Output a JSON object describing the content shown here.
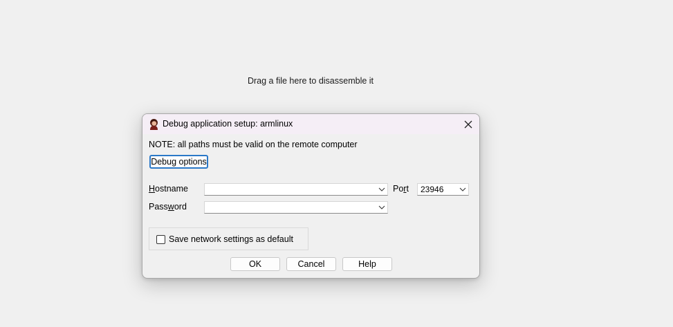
{
  "background": {
    "drop_hint": "Drag a file here to disassemble it"
  },
  "dialog": {
    "title": "Debug application setup: armlinux",
    "app_icon": "ida-avatar-icon",
    "close_icon": "close-icon",
    "note": "NOTE: all paths must be valid on the remote computer",
    "debug_options_label": "Debug options",
    "hostname": {
      "label_underlined": "H",
      "label_rest": "ostname",
      "value": ""
    },
    "port": {
      "label_pre": "Po",
      "label_underlined": "r",
      "label_post": "t",
      "value": "23946"
    },
    "password": {
      "label_pre": "Pass",
      "label_underlined": "w",
      "label_post": "ord",
      "value": ""
    },
    "save_default": {
      "label": "Save network settings as default",
      "checked": false
    },
    "buttons": {
      "ok": "OK",
      "cancel": "Cancel",
      "help": "Help"
    },
    "colors": {
      "focus_border": "#2a78c8",
      "titlebar_bg": "#f5eef6"
    }
  }
}
